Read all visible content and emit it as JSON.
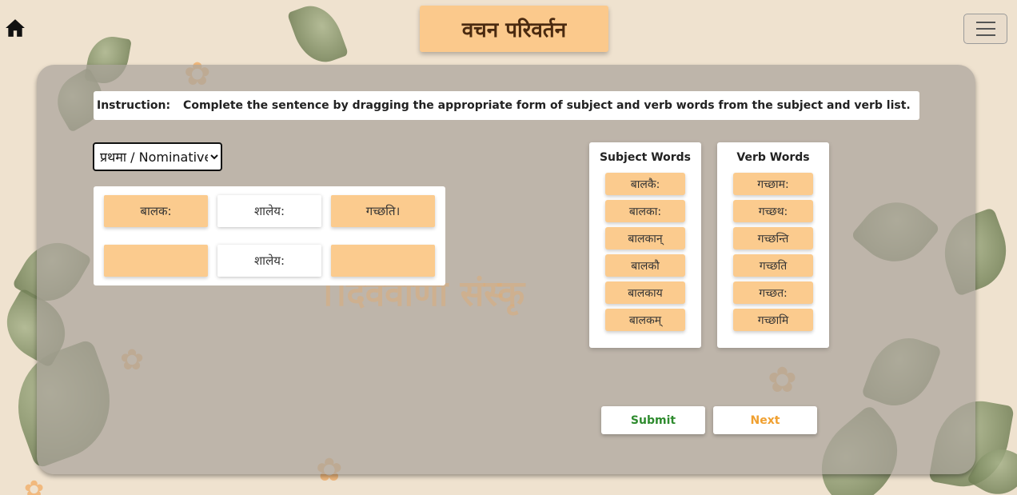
{
  "header": {
    "title": "वचन परिवर्तन",
    "home_icon": "home-icon",
    "menu_icon": "hamburger-menu-icon"
  },
  "background": {
    "watermark_text": "।।देववाणी संस्कृ"
  },
  "instruction": {
    "label": "Instruction:",
    "text": "Complete the sentence by dragging the appropriate form of subject and verb words from the subject and verb list."
  },
  "case_select": {
    "selected": "प्रथमा / Nominative",
    "options": [
      "प्रथमा / Nominative"
    ]
  },
  "sentence": {
    "row1": [
      "बालक:",
      "शालेय:",
      "गच्छति।"
    ],
    "row2": [
      "",
      "शालेय:",
      ""
    ]
  },
  "subject_words": {
    "heading": "Subject Words",
    "items": [
      "बालकै:",
      "बालका:",
      "बालकान्",
      "बालकौ",
      "बालकाय",
      "बालकम्"
    ]
  },
  "verb_words": {
    "heading": "Verb Words",
    "items": [
      "गच्छाम:",
      "गच्छथ:",
      "गच्छन्ति",
      "गच्छति",
      "गच्छत:",
      "गच्छामि"
    ]
  },
  "buttons": {
    "submit": "Submit",
    "next": "Next"
  },
  "colors": {
    "accent": "#fbcb8e",
    "submit_text": "#2e8b2e",
    "next_text": "#f0a030",
    "background": "#efe2cf"
  }
}
